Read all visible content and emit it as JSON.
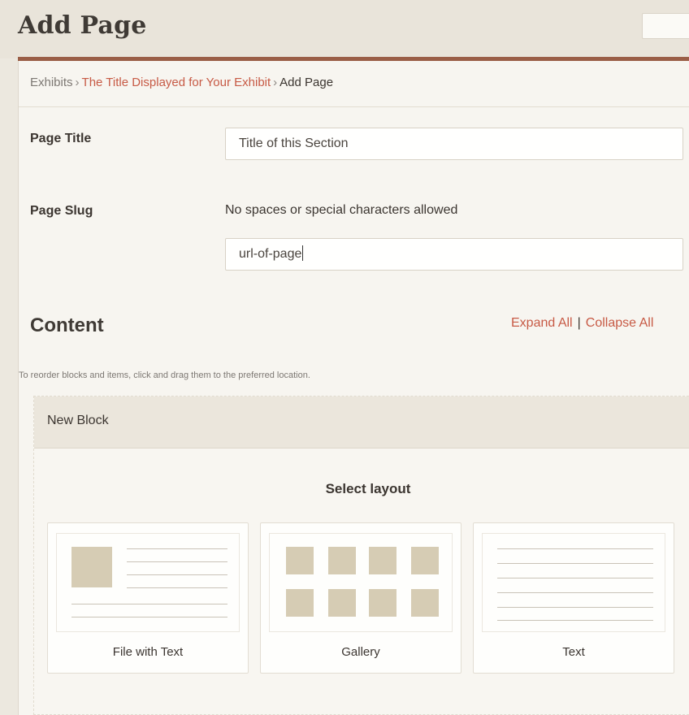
{
  "header": {
    "title": "Add Page"
  },
  "breadcrumb": {
    "items": [
      "Exhibits",
      "The Title Displayed for Your Exhibit",
      "Add Page"
    ],
    "separator": "›"
  },
  "form": {
    "page_title_label": "Page Title",
    "page_title_value": "Title of this Section",
    "page_slug_label": "Page Slug",
    "page_slug_help": "No spaces or special characters allowed",
    "page_slug_value": "url-of-page"
  },
  "content": {
    "heading": "Content",
    "expand_all": "Expand All",
    "divider": "|",
    "collapse_all": "Collapse All",
    "reorder_hint": "To reorder blocks and items, click and drag them to the preferred location.",
    "block": {
      "title": "New Block",
      "select_layout": "Select layout",
      "layouts": [
        {
          "label": "File with Text",
          "icon": "file-with-text-layout-icon"
        },
        {
          "label": "Gallery",
          "icon": "gallery-layout-icon"
        },
        {
          "label": "Text",
          "icon": "text-layout-icon"
        }
      ]
    }
  },
  "colors": {
    "accent": "#c75a45",
    "rule": "#9a5e46",
    "thumbnail": "#d6ccb4"
  }
}
